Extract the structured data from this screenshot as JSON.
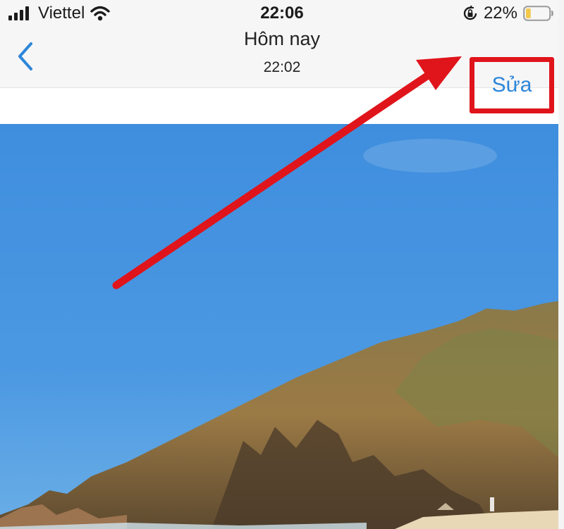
{
  "status_bar": {
    "carrier": "Viettel",
    "time": "22:06",
    "battery_percent": "22%",
    "battery_level": 0.22,
    "battery_color": "#f2c94c",
    "icons": [
      "signal-icon",
      "wifi-icon",
      "rotation-lock-icon",
      "battery-icon"
    ]
  },
  "nav": {
    "title": "Hôm nay",
    "subtitle": "22:02",
    "edit_label": "Sửa",
    "back_icon": "chevron-left-icon",
    "accent_color": "#2d86d9"
  },
  "annotation": {
    "highlight_color": "#e0141b",
    "arrow_color": "#e0141b"
  },
  "photo": {
    "subject": "beach-mountain-photo",
    "sky_color": "#4a95de"
  }
}
